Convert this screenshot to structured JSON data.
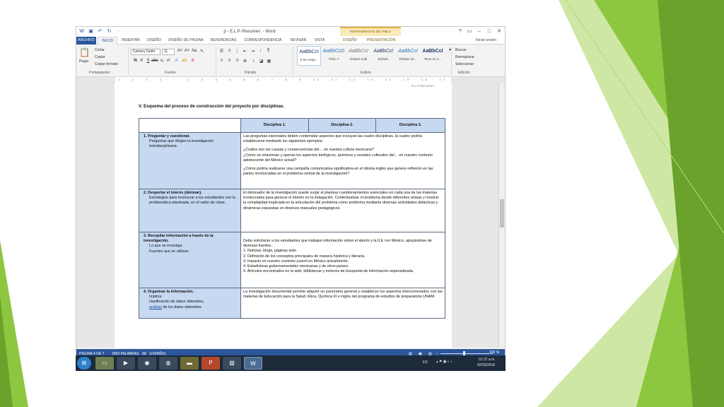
{
  "window": {
    "title": "p - E.L.P.-Resumen. - Word",
    "context_tab_title": "HERRAMIENTAS DE TABLA",
    "help": "?",
    "minimize": "–",
    "restore": "□",
    "close": "✕",
    "sign_in": "Iniciar sesión"
  },
  "tabs": [
    "ARCHIVO",
    "INICIO",
    "INSERTAR",
    "DISEÑO",
    "DISEÑO DE PÁGINA",
    "REFERENCIAS",
    "CORRESPONDENCIA",
    "REVISAR",
    "VISTA",
    "DISEÑO",
    "PRESENTACIÓN"
  ],
  "ribbon": {
    "clipboard": {
      "paste": "Pegar",
      "cut": "Cortar",
      "copy": "Copiar",
      "format_painter": "Copiar formato",
      "label": "Portapapeles"
    },
    "font": {
      "name": "Century Gothi",
      "size": "11",
      "label": "Fuente"
    },
    "paragraph": {
      "label": "Párrafo"
    },
    "styles": {
      "label": "Estilos",
      "items": [
        {
          "preview": "AaBbCcI",
          "name": "¶ Sin espa..."
        },
        {
          "preview": "AaBbCcD",
          "name": "Título 7"
        },
        {
          "preview": "AaBbCcI",
          "name": "Énfasis sutil"
        },
        {
          "preview": "AaBbCcI",
          "name": "Énfasis"
        },
        {
          "preview": "AaBbCcI",
          "name": "Énfasis int..."
        },
        {
          "preview": "AaBbCcI",
          "name": "Texto en n..."
        }
      ]
    },
    "editing": {
      "find": "Buscar",
      "replace": "Reemplazar",
      "select": "Seleccionar",
      "label": "Edición"
    }
  },
  "ruler_text": "1 · 2 · 1 · 1 · · · 1 · 2 · 3 · 4 · 5 · 6 · 7 · 8 · 9 · 10 · 11 · 12 · 13 · 14 · 15 · 16 · 17 · 18 · 19 · 20 · 21 · 22 · 23",
  "document": {
    "header": "E.L.P-Resumen.",
    "section_title": "V. Esquema del proceso de construcción del proyecto por disciplinas.",
    "table": {
      "headers": [
        "Disciplina 1.",
        "Disciplina 2.",
        "Disciplina 3."
      ],
      "rows": [
        {
          "title": "1. Preguntar y cuestionar.",
          "sub": [
            "Preguntas que dirigen la investigación interdisciplinaria."
          ],
          "content": [
            "Las preguntas esenciales deben contemplar aspectos que incluyan las cuatro disciplinas, la cuales podría establecerse mediante los siguientes ejemplos:",
            "¿Cuáles son las causas y consecuencias del… en nuestra cultura mexicana?",
            "¿Cómo se relacionan y operan los aspectos biológicos, químicos y sociales culturales del… en nuestro contexto adolescente del México actual?",
            "¿Cómo podría realizarse una campaña comunicativa significativa en el idioma inglés que genere reflexión en las partes involucradas en el problema central de la investigación?"
          ]
        },
        {
          "title": "2. Despertar el interés (detonar).",
          "sub": [
            "Estrategias para involucrar a los estudiantes con la problemática planteada, en el salón de clase."
          ],
          "content": [
            "El detonador de la investigación puede surgir al plantear cuestionamientos esenciales en cada una de las materias involucradas para generar el interés en la indagación. Contextualizar el problema desde diferentes aristas y mostrar la complejidad implicada en la articulación del problema como problema mediante diversas actividades didácticas y dinámicas expuestas en diversos manuales pedagógicos."
          ]
        },
        {
          "title": "3. Recopilar información a través de la investigación.",
          "sub": [
            "Lo que se investiga.",
            "Fuentes que se utilizan."
          ],
          "content": [
            "Debe solicitarse a los estudiantes que trabajen información sobre el aborto y la ILE i en México, apoyándose de diversas fuentes.",
            "1. Noticias, blogs, páginas web.",
            "2. Definición de los conceptos principales de manera histórica y literaria.",
            "3. Impacto en nuestro contexto juvenil en México actualmente.",
            "4. Estadísticas gubernamentales mexicanas y de otros países.",
            "5. Artículos encontrados en la web, bibliotecas y motores de búsqueda de información especializada."
          ]
        },
        {
          "title": "4. Organizar la información.",
          "sub": [
            "Implica:",
            "clasificación de datos obtenidos,"
          ],
          "sub_underlined": "análisis",
          "sub_rest": " de los datos obtenidos.",
          "content": [
            "La investigación documental permite adquirir un panorama general y establecer los aspectos interconectados con las materias de Educación para la Salud, Ética, Química III e inglés del programa de estudios de preparatoria UNAM."
          ]
        }
      ]
    }
  },
  "status": {
    "page": "PÁGINA 4 DE 7",
    "words": "1893 PALABRAS",
    "language": "ESPAÑOL",
    "zoom": "100 %"
  },
  "taskbar": {
    "lang": "ES",
    "time": "01:37 a.m.",
    "date": "02/03/2018"
  },
  "colors": {
    "word_blue": "#2b579a",
    "table_header": "#c6d9f1",
    "slide_green": "#8dc63f"
  }
}
